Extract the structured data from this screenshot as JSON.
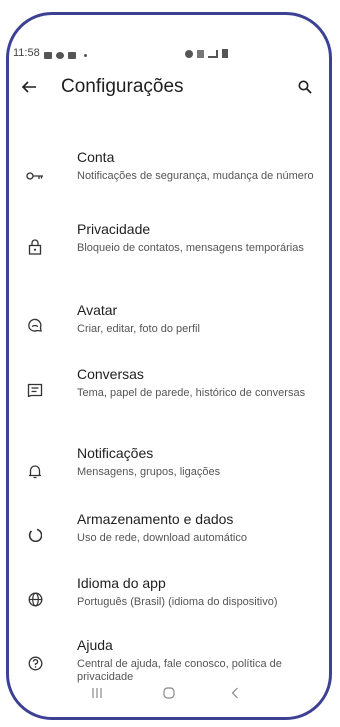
{
  "status_bar": {
    "time": "11:58"
  },
  "app_bar": {
    "title": "Configurações"
  },
  "settings": [
    {
      "label": "Conta",
      "description": "Notificações de segurança, mudança de número",
      "icon": "key-icon"
    },
    {
      "label": "Privacidade",
      "description": "Bloqueio de contatos, mensagens temporárias",
      "icon": "lock-icon"
    },
    {
      "label": "Avatar",
      "description": "Criar, editar, foto do perfil",
      "icon": "avatar-icon"
    },
    {
      "label": "Conversas",
      "description": "Tema, papel de parede, histórico de conversas",
      "icon": "chat-icon"
    },
    {
      "label": "Notificações",
      "description": "Mensagens, grupos, ligações",
      "icon": "bell-icon"
    },
    {
      "label": "Armazenamento e dados",
      "description": "Uso de rede, download automático",
      "icon": "storage-icon"
    },
    {
      "label": "Idioma do app",
      "description": "Português (Brasil) (idioma do dispositivo)",
      "icon": "globe-icon"
    },
    {
      "label": "Ajuda",
      "description": "Central de ajuda, fale conosco, política de privacidade",
      "icon": "help-icon"
    }
  ],
  "colors": {
    "frame": "#3d4194",
    "text": "#1f1f1f",
    "secondary_text": "#555555"
  }
}
